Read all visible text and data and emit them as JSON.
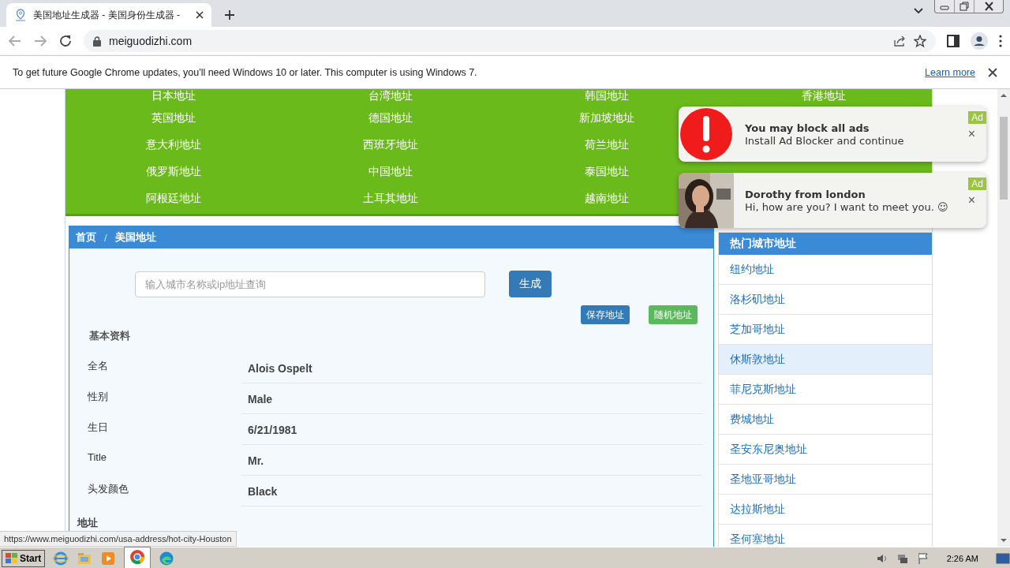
{
  "browser": {
    "tab_title": "美国地址生成器 - 美国身份生成器 -",
    "address": "meiguodizhi.com",
    "info_bar": {
      "message": "To get future Google Chrome updates, you'll need Windows 10 or later. This computer is using Windows 7.",
      "link": "Learn more"
    }
  },
  "country_links": [
    [
      "日本地址",
      "台湾地址",
      "韩国地址",
      "香港地址"
    ],
    [
      "英国地址",
      "德国地址",
      "新加坡地址"
    ],
    [
      "意大利地址",
      "西班牙地址",
      "荷兰地址"
    ],
    [
      "俄罗斯地址",
      "中国地址",
      "泰国地址"
    ],
    [
      "阿根廷地址",
      "土耳其地址",
      "越南地址"
    ]
  ],
  "breadcrumb": [
    "首页",
    "美国地址"
  ],
  "breadcrumb_separator": "/",
  "search": {
    "placeholder": "输入城市名称或ip地址查询",
    "button": "生成"
  },
  "actions": [
    {
      "label": "保存地址",
      "kind": "primary"
    },
    {
      "label": "随机地址",
      "kind": "success"
    }
  ],
  "profile": {
    "title": "基本资料",
    "fields": [
      {
        "label": "全名",
        "value": "Alois Ospelt"
      },
      {
        "label": "性别",
        "value": "Male"
      },
      {
        "label": "生日",
        "value": "6/21/1981"
      },
      {
        "label": "Title",
        "value": "Mr."
      },
      {
        "label": "头发颜色",
        "value": "Black"
      }
    ],
    "next_section": "地址"
  },
  "sidebar": {
    "title": "热门城市地址",
    "items": [
      {
        "label": "纽约地址",
        "selected": false
      },
      {
        "label": "洛杉矶地址",
        "selected": false
      },
      {
        "label": "芝加哥地址",
        "selected": false
      },
      {
        "label": "休斯敦地址",
        "selected": true
      },
      {
        "label": "菲尼克斯地址",
        "selected": false
      },
      {
        "label": "费城地址",
        "selected": false
      },
      {
        "label": "圣安东尼奥地址",
        "selected": false
      },
      {
        "label": "圣地亚哥地址",
        "selected": false
      },
      {
        "label": "达拉斯地址",
        "selected": false
      },
      {
        "label": "圣何塞地址",
        "selected": false
      }
    ]
  },
  "ads": [
    {
      "kind": "alert",
      "title": "You may block all ads",
      "text": "Install Ad Blocker and continue",
      "badge": "Ad",
      "close": "×"
    },
    {
      "kind": "picture",
      "title": "Dorothy from london",
      "text": "Hi, how are you? I want to meet you. ☺",
      "badge": "Ad",
      "close": "×"
    }
  ],
  "status_url": "https://www.meiguodizhi.com/usa-address/hot-city-Houston",
  "taskbar": {
    "start": "Start",
    "clock": "2:26 AM"
  }
}
